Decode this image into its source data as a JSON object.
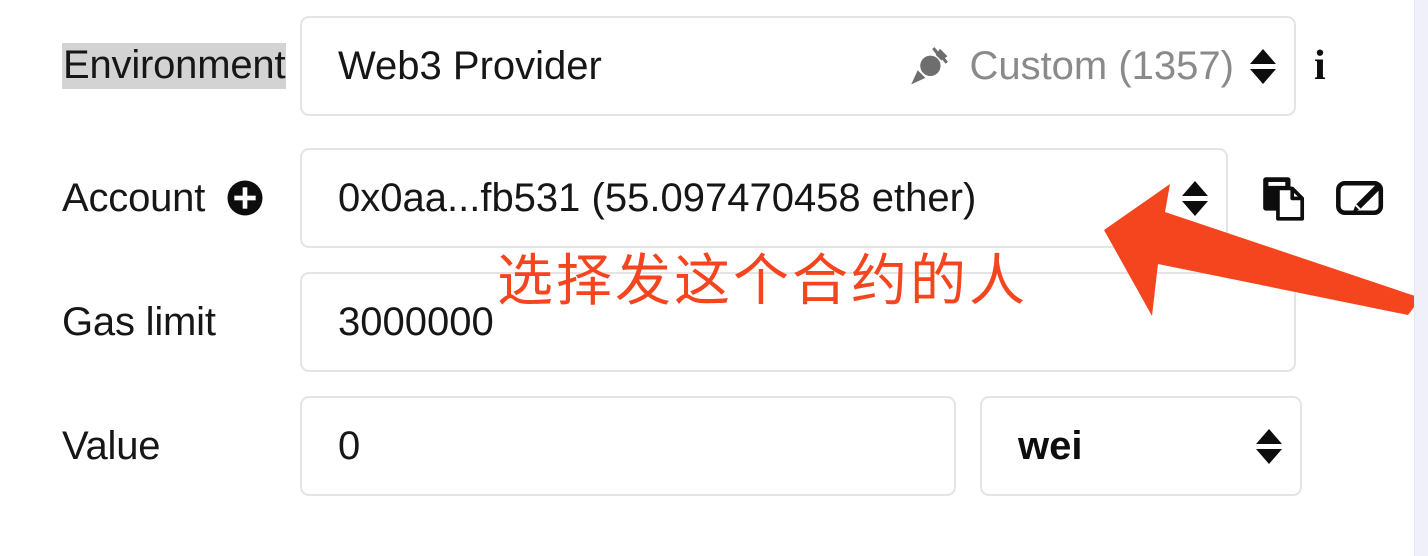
{
  "panel": {
    "rows": [
      {
        "label": "Environment",
        "label_highlighted": true,
        "value_main": "Web3 Provider",
        "value_muted": "Custom (1357)",
        "plug_icon": "plug-icon",
        "spinner_icon": "spinner-updown-icon",
        "trailing_icon": "info-icon",
        "trailing_icon_glyph": "i"
      },
      {
        "label": "Account",
        "add_icon": "plus-circle-icon",
        "value_main": "0x0aa...fb531 (55.097470458 ether)",
        "spinner_icon": "spinner-updown-icon",
        "copy_icon": "copy-icon",
        "sign_icon": "sign-message-icon"
      },
      {
        "label": "Gas limit",
        "value_main": "3000000"
      },
      {
        "label": "Value",
        "value_main": "0",
        "unit_value": "wei",
        "unit_spinner_icon": "spinner-updown-icon"
      }
    ]
  },
  "annotation": {
    "text": "选择发这个合约的人",
    "color": "#f5451f",
    "arrow_icon": "red-arrow-icon",
    "arrow_direction": "up-left"
  },
  "colors": {
    "accent_red": "#f5451f",
    "field_border": "#e4e4e4",
    "muted_text": "#8a8a8a",
    "label_highlight": "#d3d3d3",
    "panel_edge": "#eff0fa"
  }
}
